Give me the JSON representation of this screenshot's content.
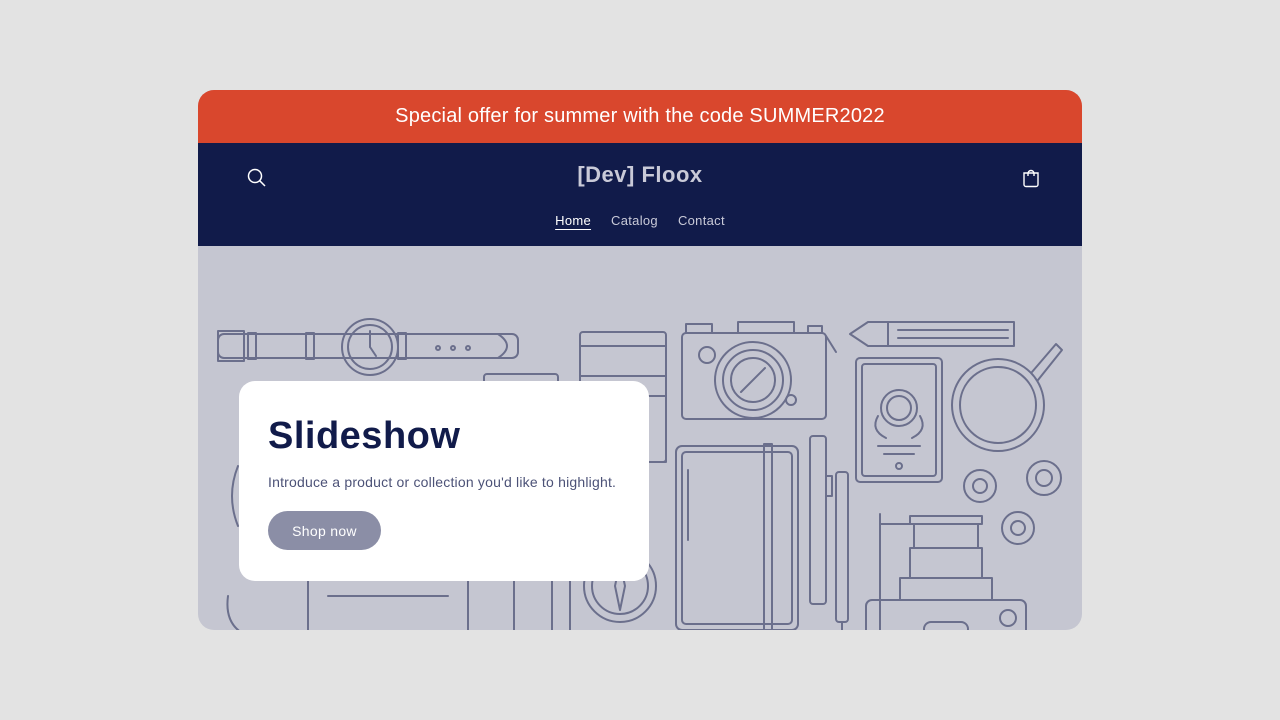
{
  "announcement": {
    "text": "Special offer for summer with the code SUMMER2022"
  },
  "header": {
    "logo": "[Dev] Floox",
    "nav": [
      "Home",
      "Catalog",
      "Contact"
    ],
    "active_nav": "Home",
    "search_icon": "search-icon",
    "cart_icon": "cart-icon"
  },
  "hero": {
    "title": "Slideshow",
    "text": "Introduce a product or collection you'd like to highlight.",
    "button_label": "Shop now"
  },
  "colors": {
    "announcement_bg": "#d9472d",
    "header_bg": "#111b4a",
    "hero_bg": "#c5c6d1",
    "line_art": "#6b6f8c",
    "button_bg": "#8b8ea6"
  }
}
